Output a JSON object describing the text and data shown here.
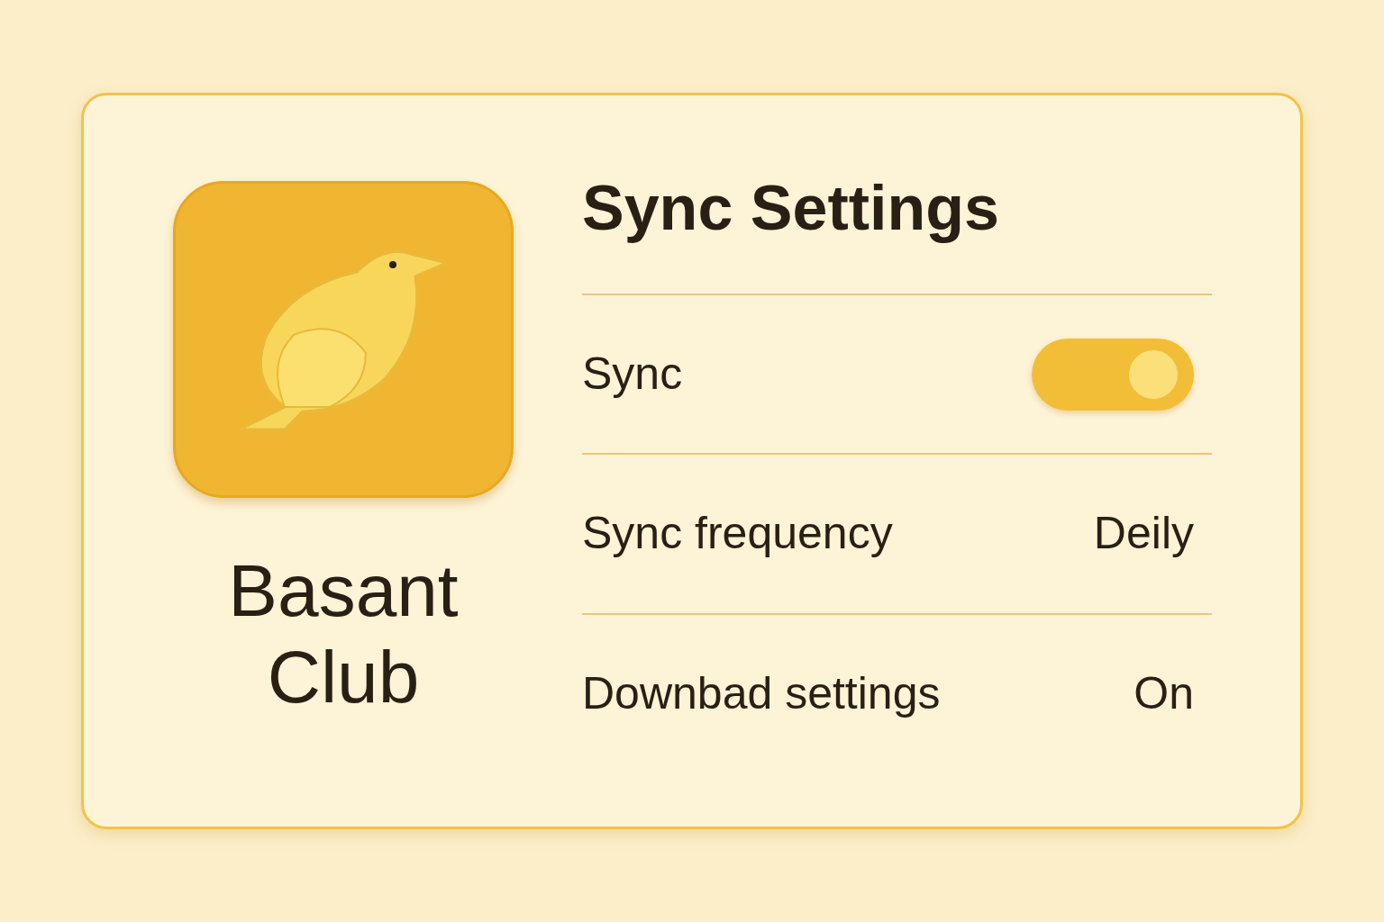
{
  "app": {
    "name": "Basant Club"
  },
  "panel": {
    "title": "Sync Settings",
    "rows": [
      {
        "kind": "toggle",
        "label": "Sync",
        "on": true
      },
      {
        "kind": "value",
        "label": "Sync frequency",
        "value": "Deily"
      },
      {
        "kind": "value",
        "label": "Downbad settings",
        "value": "On"
      }
    ]
  }
}
